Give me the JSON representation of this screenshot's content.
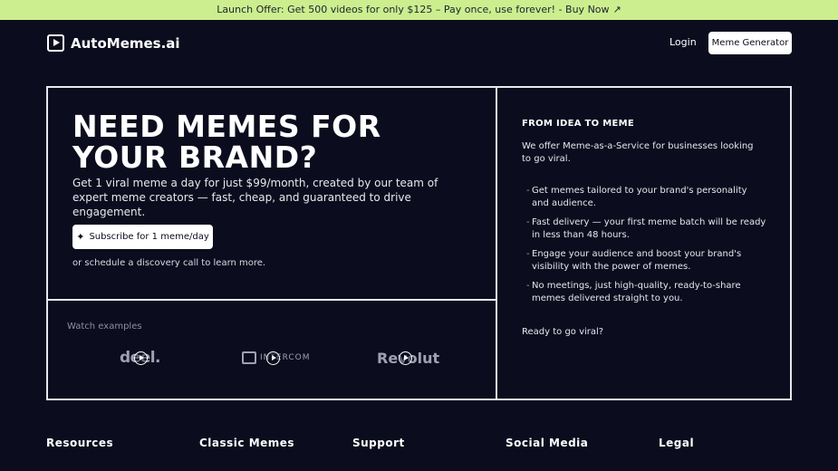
{
  "banner": {
    "text": "Launch Offer: Get 500 videos for only $125 – Pay once, use forever! - Buy Now",
    "arrow_icon": "arrow-up-right-icon"
  },
  "nav": {
    "brand": "AutoMemes.ai",
    "login": "Login",
    "cta": "Meme Generator"
  },
  "hero": {
    "title": "NEED MEMES FOR YOUR BRAND?",
    "subtitle": "Get 1 viral meme a day for just $99/month, created by our team of expert meme creators — fast, cheap, and guaranteed to drive engagement.",
    "subscribe_label": "Subscribe for 1 meme/day",
    "schedule": "or schedule a discovery call to learn more."
  },
  "examples": {
    "label": "Watch examples",
    "logos": [
      "deel.",
      "INTERCOM",
      "Revolut"
    ]
  },
  "info": {
    "heading": "FROM IDEA TO MEME",
    "intro": "We offer Meme-as-a-Service for businesses looking to go viral.",
    "bullets": [
      "Get memes tailored to your brand's personality and audience.",
      "Fast delivery — your first meme batch will be ready in less than 48 hours.",
      "Engage your audience and boost your brand's visibility with the power of memes.",
      "No meetings, just high-quality, ready-to-share memes delivered straight to you."
    ],
    "closing": "Ready to go viral?"
  },
  "footer": {
    "columns": [
      "Resources",
      "Classic Memes",
      "Support",
      "Social Media",
      "Legal"
    ]
  },
  "colors": {
    "background": "#0b0d1e",
    "banner": "#cdee8e",
    "border": "#e8e8ef",
    "muted": "#8d8fa2"
  }
}
